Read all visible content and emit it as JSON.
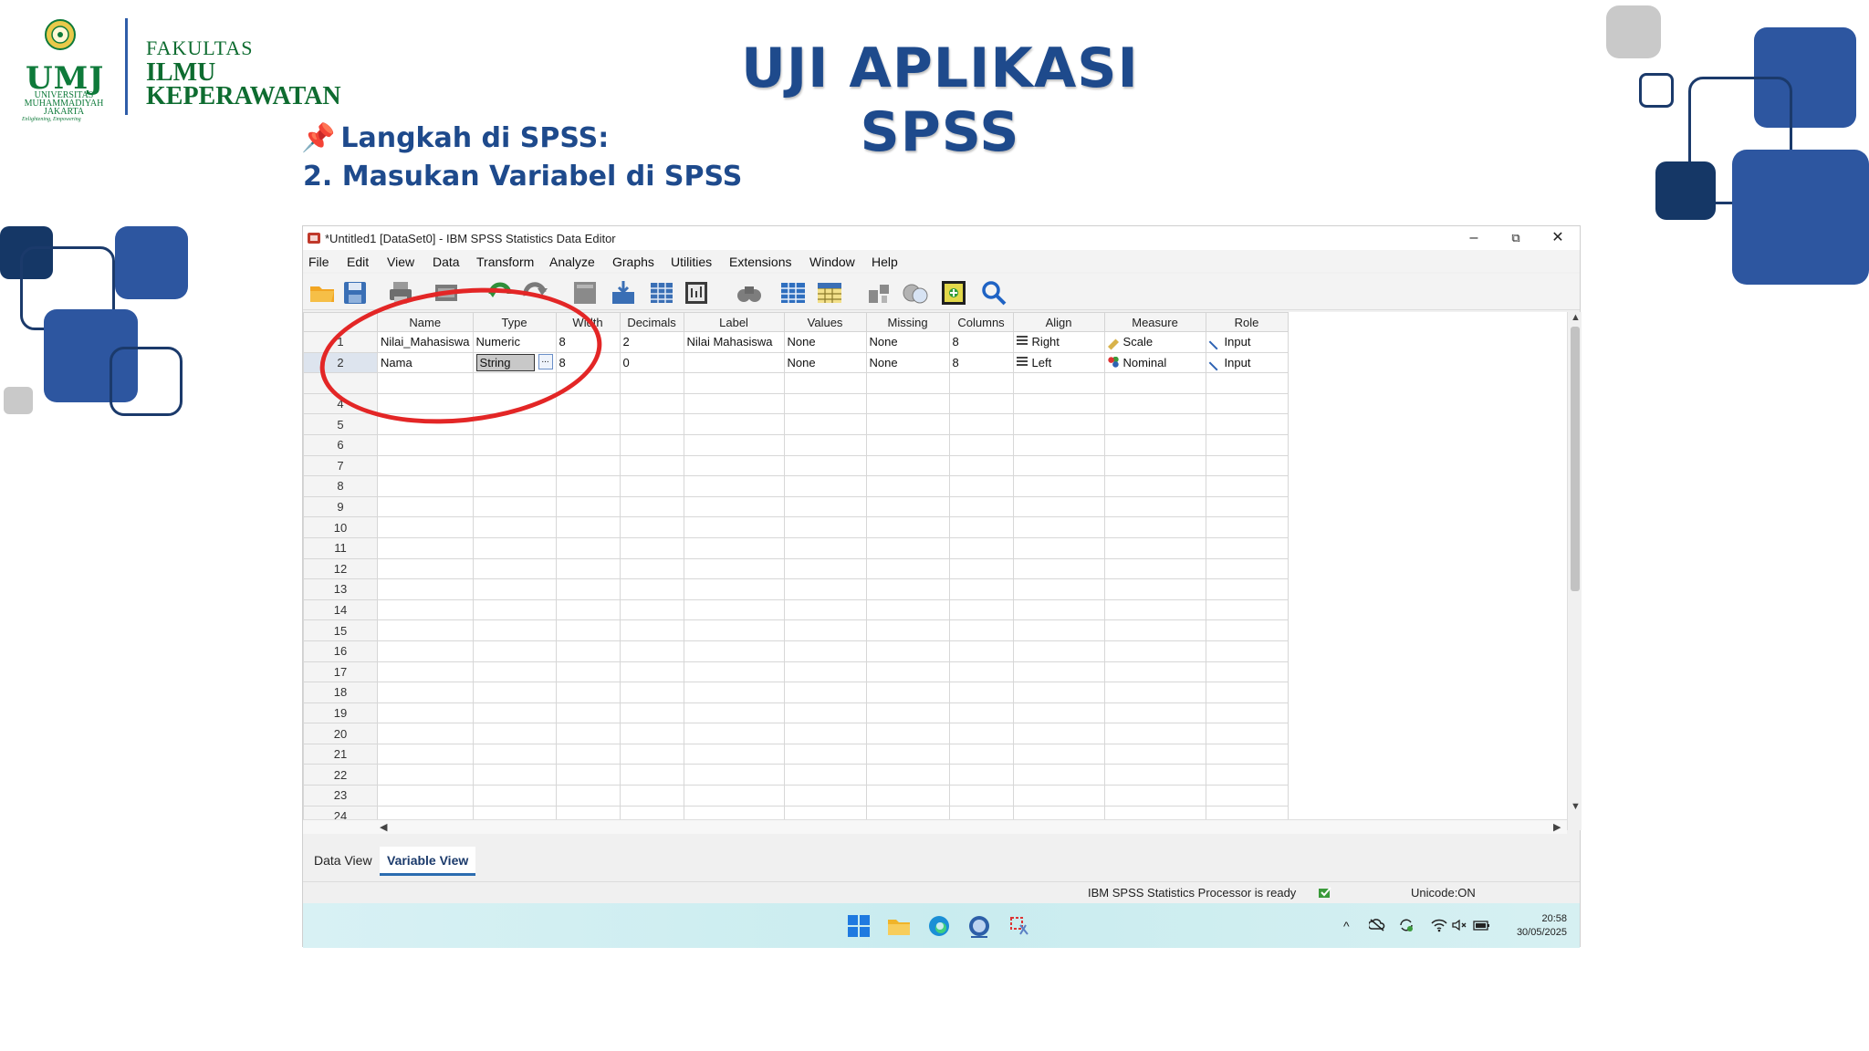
{
  "slide": {
    "title": "UJI APLIKASI SPSS",
    "step_heading": "Langkah di SPSS:",
    "step_sub": "2. Masukan Variabel di SPSS"
  },
  "logo": {
    "abbr": "UMJ",
    "university": "UNIVERSITAS MUHAMMADIYAH JAKARTA",
    "tagline": "Enlightening, Empowering",
    "faculty_line1": "FAKULTAS",
    "faculty_line2": "ILMU",
    "faculty_line3": "KEPERAWATAN"
  },
  "window": {
    "title": "*Untitled1 [DataSet0] - IBM SPSS Statistics Data Editor",
    "controls": [
      "–",
      "⧉",
      "✕"
    ]
  },
  "menu": [
    "File",
    "Edit",
    "View",
    "Data",
    "Transform",
    "Analyze",
    "Graphs",
    "Utilities",
    "Extensions",
    "Window",
    "Help"
  ],
  "toolbar_icons": [
    "open-folder-icon",
    "save-icon",
    "print-icon",
    "recall-dialog-icon",
    "undo-icon",
    "redo-icon",
    "goto-case-icon",
    "goto-variable-icon",
    "variables-icon",
    "run-descriptives-icon",
    "find-icon",
    "insert-cases-icon",
    "insert-variable-icon",
    "split-file-icon",
    "weight-cases-icon",
    "select-cases-icon",
    "value-labels-icon",
    "search-icon"
  ],
  "grid": {
    "columns": [
      "Name",
      "Type",
      "Width",
      "Decimals",
      "Label",
      "Values",
      "Missing",
      "Columns",
      "Align",
      "Measure",
      "Role"
    ],
    "rows": [
      {
        "num": "1",
        "name": "Nilai_Mahasiswa",
        "type": "Numeric",
        "width": "8",
        "decimals": "2",
        "label": "Nilai Mahasiswa",
        "values": "None",
        "missing": "None",
        "columns": "8",
        "align": "Right",
        "measure": "Scale",
        "role": "Input"
      },
      {
        "num": "2",
        "name": "Nama",
        "type": "String",
        "width": "8",
        "decimals": "0",
        "label": "",
        "values": "None",
        "missing": "None",
        "columns": "8",
        "align": "Left",
        "measure": "Nominal",
        "role": "Input"
      }
    ],
    "empty_rows": [
      "",
      "4",
      "5",
      "6",
      "7",
      "8",
      "9",
      "10",
      "11",
      "12",
      "13",
      "14",
      "15",
      "16",
      "17",
      "18",
      "19",
      "20",
      "21",
      "22",
      "23",
      "24"
    ],
    "type_button": "..."
  },
  "tabs": {
    "data_view": "Data View",
    "variable_view": "Variable View"
  },
  "status": {
    "processor": "IBM SPSS Statistics Processor is ready",
    "unicode": "Unicode:ON"
  },
  "taskbar": {
    "time": "20:58",
    "date": "30/05/2025",
    "tray_chevron": "^"
  },
  "colors": {
    "accent_blue": "#1e4a8c",
    "dark_navy": "#153766",
    "light_gray": "#c8c8c8",
    "highlight_ring": "#e32626",
    "umj_green": "#0e7a3a"
  }
}
